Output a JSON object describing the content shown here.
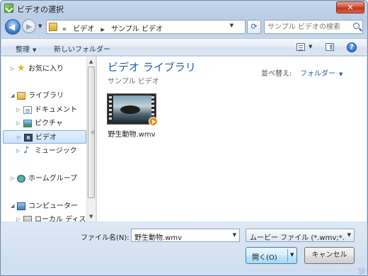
{
  "window": {
    "title": "ビデオの選択",
    "close_label": "✕"
  },
  "nav": {
    "back_glyph": "◀",
    "forward_glyph": "▶",
    "breadcrumb_prefix": "«",
    "breadcrumb": [
      "ビデオ",
      "サンプル ビデオ"
    ],
    "crumb_separator": "▶",
    "refresh_glyph": "⟳",
    "search_placeholder": "サンプル ビデオの検索"
  },
  "toolbar": {
    "organize": "整理",
    "new_folder": "新しいフォルダー",
    "help": "?"
  },
  "sidebar": {
    "favorites": "お気に入り",
    "libraries": "ライブラリ",
    "documents": "ドキュメント",
    "pictures": "ピクチャ",
    "videos": "ビデオ",
    "music": "ミュージック",
    "homegroup": "ホームグループ",
    "computer": "コンピューター",
    "local_disk": "ローカル ディスク"
  },
  "main": {
    "library_title": "ビデオ ライブラリ",
    "library_subtitle": "サンプル ビデオ",
    "arrange_label": "並べ替え:",
    "arrange_value": "フォルダー",
    "files": [
      {
        "name": "野生動物.wmv"
      }
    ]
  },
  "bottom": {
    "filename_label": "ファイル名(N):",
    "filename_value": "野生動物.wmv",
    "filetype_value": "ムービー ファイル (*.wmv;*.",
    "open_label": "開く(O)",
    "cancel_label": "キャンセル"
  },
  "colors": {
    "accent": "#1e5fa8",
    "close": "#c23318",
    "selection": "#cde4fb"
  }
}
